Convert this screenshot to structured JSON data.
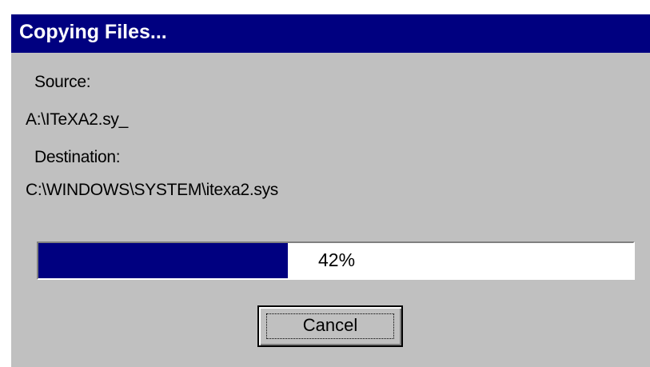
{
  "window": {
    "title": "Copying Files...",
    "title_bar_color": "#000080",
    "background_color": "#c0c0c0"
  },
  "labels": {
    "source_heading": "Source:",
    "source_path": "A:\\ITeXA2.sy_",
    "destination_heading": "Destination:",
    "destination_path": "C:\\WINDOWS\\SYSTEM\\itexa2.sys"
  },
  "progress": {
    "percent": 42,
    "text": "42%",
    "fill_color": "#000080"
  },
  "buttons": {
    "cancel_label": "Cancel"
  }
}
